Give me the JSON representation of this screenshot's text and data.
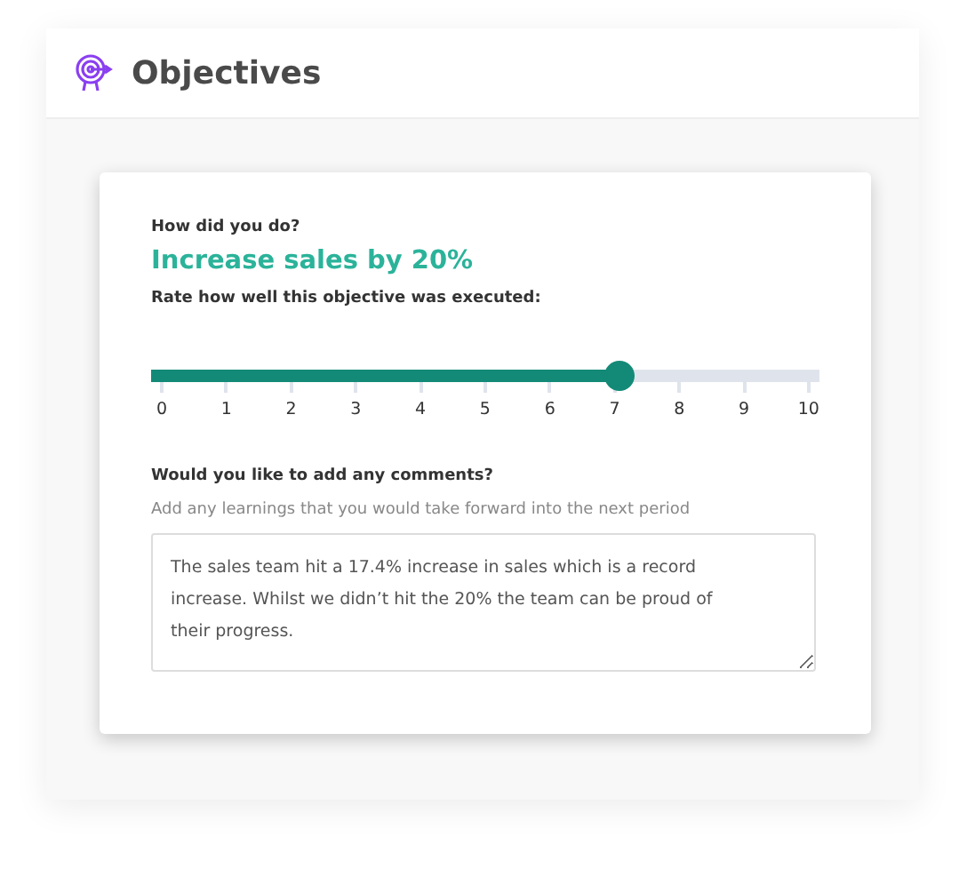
{
  "header": {
    "title": "Objectives"
  },
  "card": {
    "question": "How did you do?",
    "objective": "Increase sales by 20%",
    "rate_label": "Rate how well this objective was executed:",
    "slider": {
      "level": 0.7,
      "ticks": [
        "0",
        "1",
        "2",
        "3",
        "4",
        "5",
        "6",
        "7",
        "8",
        "9",
        "10"
      ]
    },
    "comments_label": "Would you like to add any comments?",
    "comments_hint": "Add any learnings that you would take forward into the next period",
    "comments_value": "The sales team hit a 17.4% increase in sales which is a record increase. Whilst we didn’t hit the 20% the team can be proud of their progress."
  }
}
